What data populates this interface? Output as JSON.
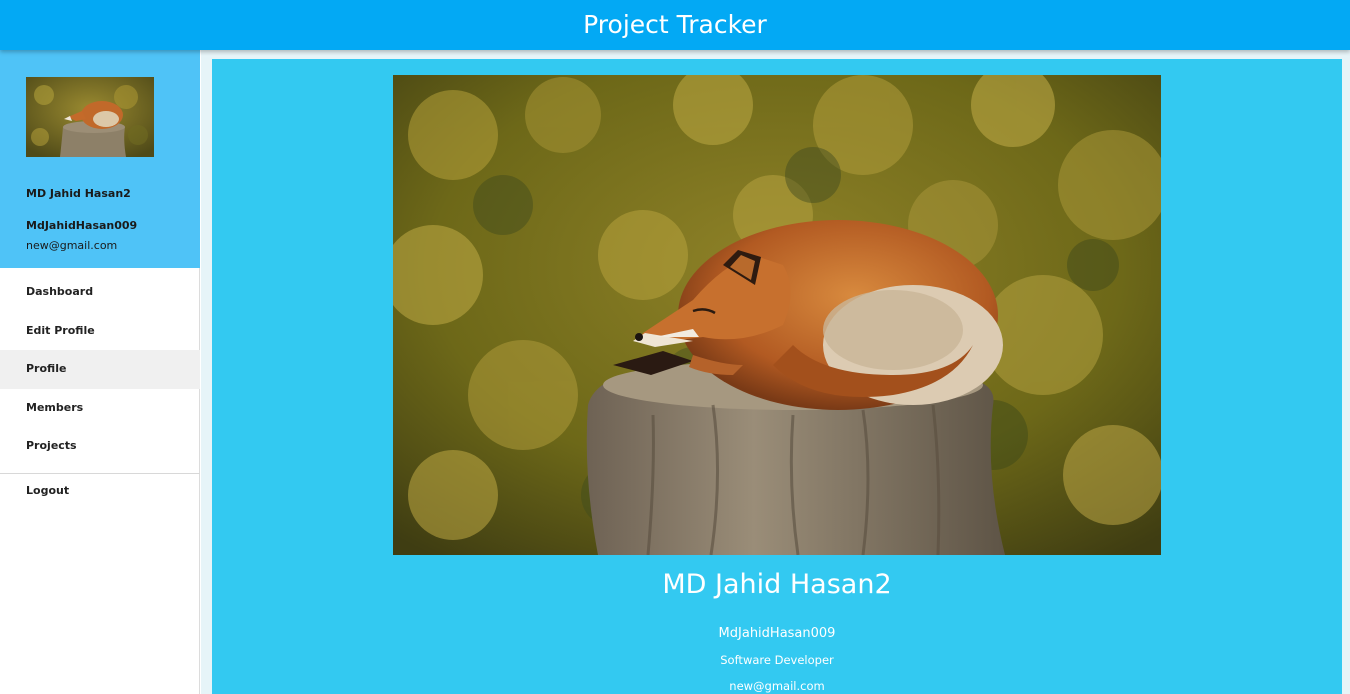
{
  "app": {
    "title": "Project Tracker"
  },
  "sidebar": {
    "avatar_alt": "fox-on-stump-photo",
    "name": "MD Jahid Hasan2",
    "username": "MdJahidHasan009",
    "email": "new@gmail.com",
    "items": [
      {
        "label": "Dashboard",
        "active": false
      },
      {
        "label": "Edit Profile",
        "active": false
      },
      {
        "label": "Profile",
        "active": true
      },
      {
        "label": "Members",
        "active": false
      },
      {
        "label": "Projects",
        "active": false
      }
    ],
    "logout_label": "Logout"
  },
  "profile": {
    "name": "MD Jahid Hasan2",
    "username": "MdJahidHasan009",
    "role": "Software Developer",
    "email": "new@gmail.com"
  },
  "colors": {
    "topbar": "#03a9f4",
    "sidebar_header": "#4fc3f7",
    "card": "#33c9f1",
    "main_background": "#e6f4f8",
    "active_item": "#f0f0f0"
  }
}
